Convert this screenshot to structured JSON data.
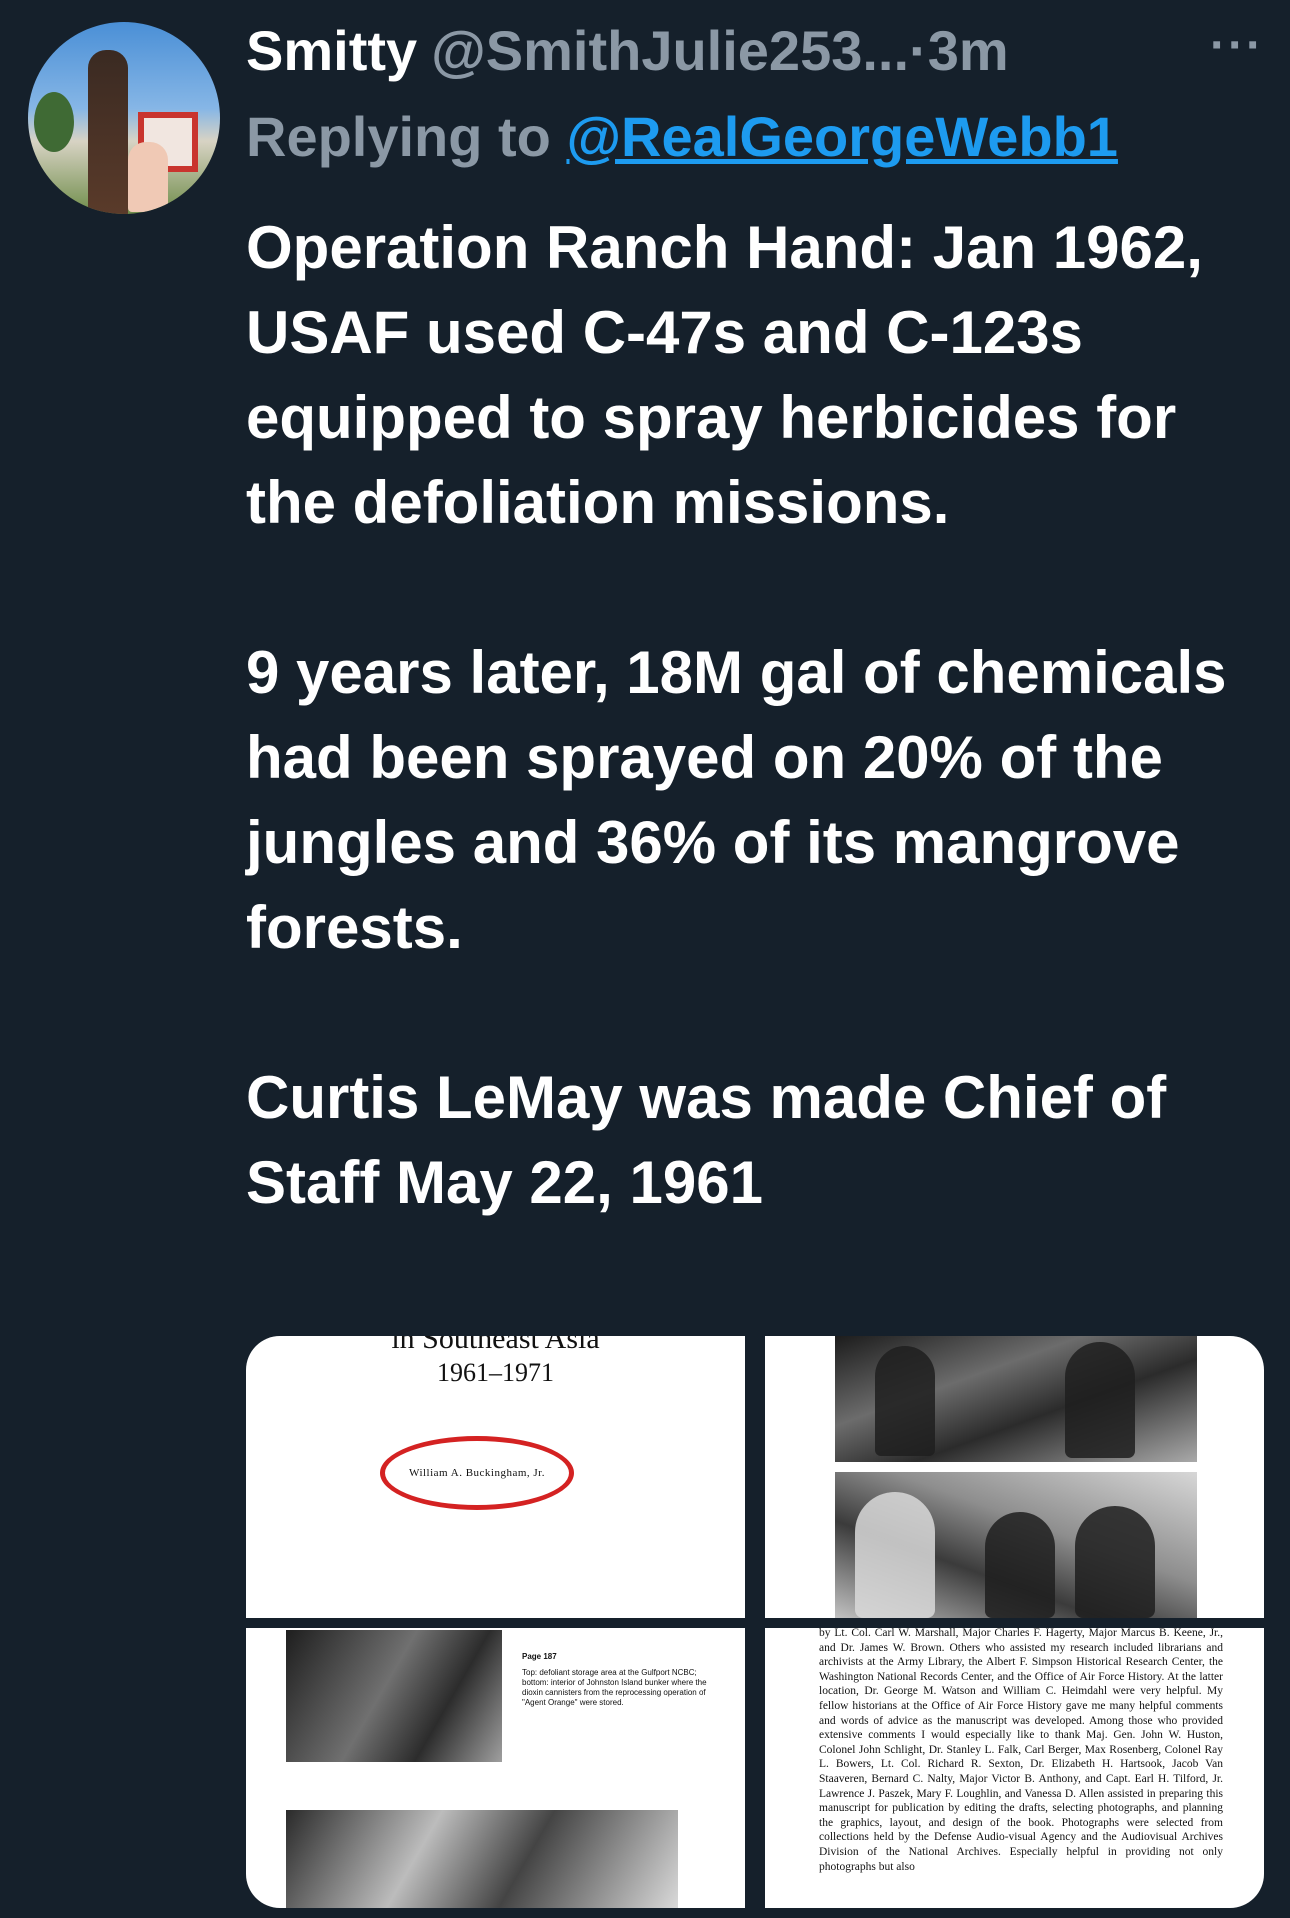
{
  "author": {
    "display_name": "Smitty",
    "handle": "@SmithJulie253...",
    "separator": "·",
    "time": "3m",
    "more_icon": "ellipsis-icon",
    "more_label": "···"
  },
  "reply": {
    "prefix": "Replying to",
    "mention": "@RealGeorgeWebb1"
  },
  "tweet": {
    "paragraphs": [
      "Operation Ranch Hand: Jan 1962, USAF used C-47s and C-123s equipped to spray herbicides for the defoliation missions.",
      "9 years later, 18M gal of chemicals had been sprayed on 20% of the jungles and 36% of its mangrove forests.",
      "Curtis LeMay was made Chief of Staff May 22, 1961"
    ]
  },
  "media": {
    "tile1": {
      "title": "in Southeast Asia",
      "years": "1961–1971",
      "author": "William A. Buckingham, Jr."
    },
    "tile3": {
      "page": "Page 187",
      "caption": "Top: defoliant storage area at the Gulfport NCBC; bottom: interior of Johnston Island bunker where the dioxin cannisters from the reprocessing operation of \"Agent Orange\" were stored."
    },
    "tile4": {
      "text": "by Lt. Col. Carl W. Marshall, Major Charles F. Hagerty, Major Marcus B. Keene, Jr., and Dr. James W. Brown. Others who assisted my research included librarians and archivists at the Army Library, the Albert F. Simpson Historical Research Center, the Washington National Records Center, and the Office of Air Force History. At the latter location, Dr. George M. Watson and William C. Heimdahl were very helpful. My fellow historians at the Office of Air Force History gave me many helpful comments and words of advice as the manuscript was developed. Among those who provided extensive comments I would especially like to thank Maj. Gen. John W. Huston, Colonel John Schlight, Dr. Stanley L. Falk, Carl Berger, Max Rosenberg, Colonel Ray L. Bowers, Lt. Col. Richard R. Sexton, Dr. Elizabeth H. Hartsook, Jacob Van Staaveren, Bernard C. Nalty, Major Victor B. Anthony, and Capt. Earl H. Tilford, Jr. Lawrence J. Paszek, Mary F. Loughlin, and Vanessa D. Allen assisted in preparing this manuscript for publication by editing the drafts, selecting photographs, and planning the graphics, layout, and design of the book. Photographs were selected from collections held by the Defense Audio-visual Agency and the Audiovisual Archives Division of the National Archives. Especially helpful in providing not only photographs but also"
    }
  }
}
